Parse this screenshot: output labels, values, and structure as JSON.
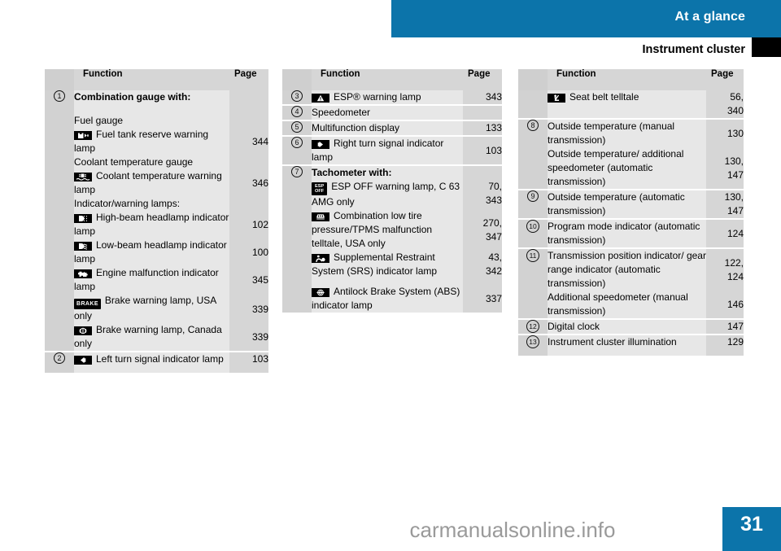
{
  "header": {
    "section_title": "At a glance",
    "page_title": "Instrument cluster"
  },
  "footer": {
    "page_number": "31",
    "watermark": "carmanualsonline.info"
  },
  "colors": {
    "accent_blue": "#0c74aa",
    "header_gray": "#d6d6d6",
    "num_col_gray": "#d2d2d2",
    "fn_col_gray": "#e7e7e7",
    "telltale_black": "#000000"
  },
  "columns": [
    {
      "headers": {
        "function": "Function",
        "page": "Page"
      },
      "rows": [
        {
          "num": "1",
          "bold": true,
          "icon": "",
          "text": "Combination gauge with:",
          "page": ""
        },
        {
          "num": "",
          "bold": false,
          "icon": "",
          "text": "Fuel gauge",
          "page": ""
        },
        {
          "num": "",
          "bold": false,
          "icon": "fuel-tank-reserve-icon",
          "text": "Fuel tank reserve warning lamp",
          "page": "344"
        },
        {
          "num": "",
          "bold": false,
          "icon": "",
          "text": "Coolant temperature gauge",
          "page": ""
        },
        {
          "num": "",
          "bold": false,
          "icon": "coolant-temperature-icon",
          "text": "Coolant temperature warning lamp",
          "page": "346"
        },
        {
          "num": "",
          "bold": false,
          "icon": "",
          "text": "Indicator/warning lamps:",
          "page": ""
        },
        {
          "num": "",
          "bold": false,
          "icon": "high-beam-headlamp-icon",
          "text": "High-beam headlamp indicator lamp",
          "page": "102"
        },
        {
          "num": "",
          "bold": false,
          "icon": "low-beam-headlamp-icon",
          "text": "Low-beam headlamp indicator lamp",
          "page": "100"
        },
        {
          "num": "",
          "bold": false,
          "icon": "engine-malfunction-icon",
          "text": "Engine malfunction indicator lamp",
          "page": "345"
        },
        {
          "num": "",
          "bold": false,
          "icon": "brake-warning-usa-icon",
          "text": "Brake warning lamp, USA only",
          "page": "339"
        },
        {
          "num": "",
          "bold": false,
          "icon": "brake-warning-canada-icon",
          "text": "Brake warning lamp, Canada only",
          "page": "339"
        },
        {
          "num": "2",
          "bold": false,
          "icon": "left-turn-signal-icon",
          "text": "Left turn signal indicator lamp",
          "page": "103"
        }
      ]
    },
    {
      "headers": {
        "function": "Function",
        "page": "Page"
      },
      "rows": [
        {
          "num": "3",
          "bold": false,
          "icon": "esp-warning-icon",
          "text": "ESP® warning lamp",
          "page": "343"
        },
        {
          "num": "4",
          "bold": false,
          "icon": "",
          "text": "Speedometer",
          "page": ""
        },
        {
          "num": "5",
          "bold": false,
          "icon": "",
          "text": "Multifunction display",
          "page": "133"
        },
        {
          "num": "6",
          "bold": false,
          "icon": "right-turn-signal-icon",
          "text": "Right turn signal indicator lamp",
          "page": "103"
        },
        {
          "num": "7",
          "bold": true,
          "icon": "",
          "text": "Tachometer with:",
          "page": ""
        },
        {
          "num": "",
          "bold": false,
          "icon": "esp-off-icon",
          "text": "ESP OFF warning lamp, C 63 AMG only",
          "page": "70,\n343"
        },
        {
          "num": "",
          "bold": false,
          "icon": "low-tire-pressure-icon",
          "text": "Combination low tire pressure/TPMS malfunction telltale, USA only",
          "page": "270,\n347"
        },
        {
          "num": "",
          "bold": false,
          "icon": "srs-airbag-icon",
          "text": "Supplemental Restraint System (SRS) indicator lamp",
          "page": "43,\n342"
        },
        {
          "num": "",
          "bold": false,
          "icon": "abs-icon",
          "text": "Antilock Brake System (ABS) indicator lamp",
          "page": "337"
        }
      ]
    },
    {
      "headers": {
        "function": "Function",
        "page": "Page"
      },
      "rows": [
        {
          "num": "",
          "bold": false,
          "icon": "seat-belt-telltale-icon",
          "text": "Seat belt telltale",
          "page": "56,\n340"
        },
        {
          "num": "8",
          "bold": false,
          "icon": "",
          "text": "Outside temperature (manual transmission)",
          "page": "130"
        },
        {
          "num": "",
          "bold": false,
          "icon": "",
          "text": "Outside temperature/ additional speedometer (automatic transmission)",
          "page": "130,\n147"
        },
        {
          "num": "9",
          "bold": false,
          "icon": "",
          "text": "Outside temperature (automatic transmission)",
          "page": "130,\n147"
        },
        {
          "num": "10",
          "bold": false,
          "icon": "",
          "text": "Program mode indicator (automatic transmission)",
          "page": "124"
        },
        {
          "num": "11",
          "bold": false,
          "icon": "",
          "text": "Transmission position indicator/ gear range indicator (automatic transmission)",
          "page": "122,\n124"
        },
        {
          "num": "",
          "bold": false,
          "icon": "",
          "text": "Additional speedometer (manual transmission)",
          "page": "146"
        },
        {
          "num": "12",
          "bold": false,
          "icon": "",
          "text": "Digital clock",
          "page": "147"
        },
        {
          "num": "13",
          "bold": false,
          "icon": "",
          "text": "Instrument cluster illumination",
          "page": "129"
        }
      ]
    }
  ]
}
